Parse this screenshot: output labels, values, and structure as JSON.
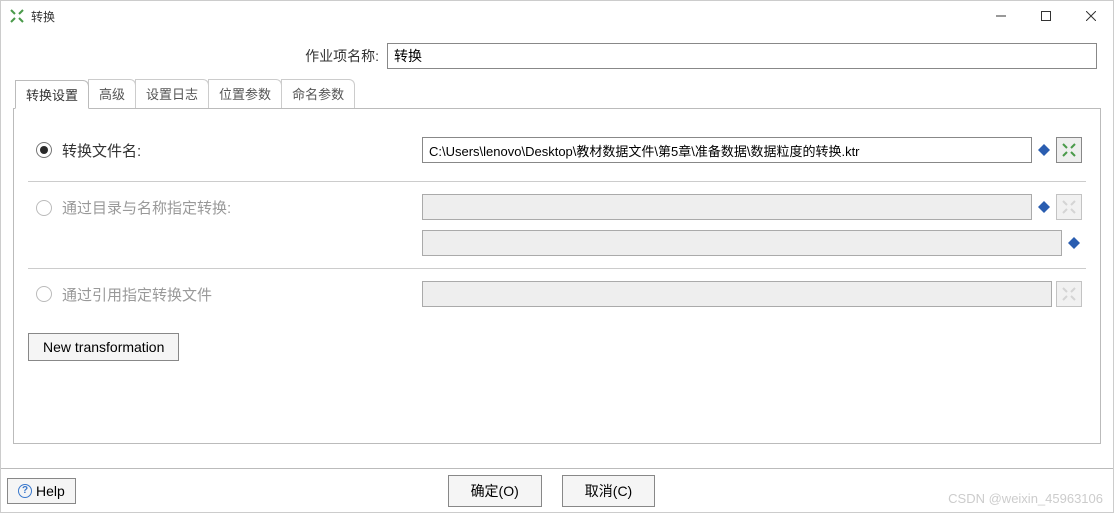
{
  "window": {
    "title": "转换"
  },
  "form": {
    "name_label": "作业项名称:",
    "name_value": "转换"
  },
  "tabs": [
    "转换设置",
    "高级",
    "设置日志",
    "位置参数",
    "命名参数"
  ],
  "radio": {
    "file_label": "转换文件名:",
    "file_value": "C:\\Users\\lenovo\\Desktop\\教材数据文件\\第5章\\准备数据\\数据粒度的转换.ktr",
    "dirname_label": "通过目录与名称指定转换:",
    "ref_label": "通过引用指定转换文件"
  },
  "buttons": {
    "new_trans": "New transformation",
    "help": "Help",
    "ok": "确定(O)",
    "cancel": "取消(C)"
  },
  "watermark": "CSDN @weixin_45963106"
}
